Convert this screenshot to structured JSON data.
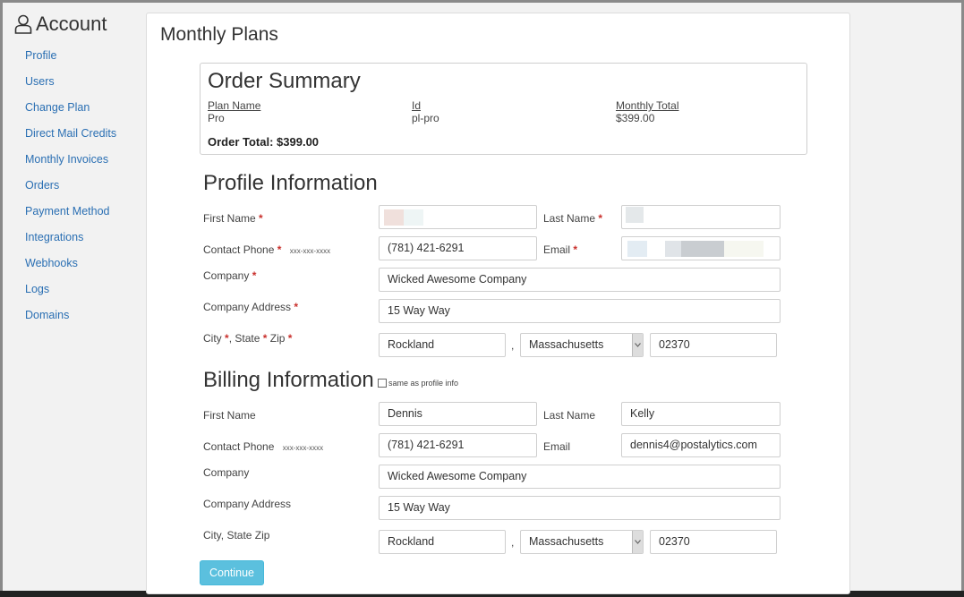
{
  "sidebar": {
    "title": "Account",
    "items": [
      "Profile",
      "Users",
      "Change Plan",
      "Direct Mail Credits",
      "Monthly Invoices",
      "Orders",
      "Payment Method",
      "Integrations",
      "Webhooks",
      "Logs",
      "Domains"
    ]
  },
  "main": {
    "title": "Monthly Plans",
    "order_summary": {
      "title": "Order Summary",
      "columns": [
        {
          "header": "Plan Name",
          "value": "Pro"
        },
        {
          "header": "Id",
          "value": "pl-pro"
        },
        {
          "header": "Monthly Total",
          "value": "$399.00"
        }
      ],
      "total": "Order Total: $399.00"
    },
    "profile": {
      "title": "Profile Information",
      "first_name_label": "First Name",
      "last_name_label": "Last Name",
      "phone_label": "Contact Phone",
      "phone_hint": "xxx-xxx-xxxx",
      "phone_value": "(781) 421-6291",
      "email_label": "Email",
      "company_label": "Company",
      "company_value": "Wicked Awesome Company",
      "address_label": "Company Address",
      "address_value": "15 Way Way",
      "city_label": "City",
      "state_label": "State",
      "zip_label": "Zip",
      "city_value": "Rockland",
      "state_value": "Massachusetts",
      "zip_value": "02370",
      "required_mark": "*",
      "comma": ","
    },
    "billing": {
      "title": "Billing Information",
      "same_as_label": "same as profile info",
      "first_name_label": "First Name",
      "first_name_value": "Dennis",
      "last_name_label": "Last Name",
      "last_name_value": "Kelly",
      "phone_label": "Contact Phone",
      "phone_hint": "xxx-xxx-xxxx",
      "phone_value": "(781) 421-6291",
      "email_label": "Email",
      "email_value": "dennis4@postalytics.com",
      "company_label": "Company",
      "company_value": "Wicked Awesome Company",
      "address_label": "Company Address",
      "address_value": "15 Way Way",
      "city_state_zip_label": "City, State Zip",
      "city_value": "Rockland",
      "state_value": "Massachusetts",
      "zip_value": "02370",
      "comma": ","
    },
    "continue_label": "Continue"
  },
  "colors": {
    "link": "#2a6fb3",
    "required": "#c9302c",
    "button": "#5bc0de"
  },
  "icons": {
    "account": "user-outline-icon",
    "select": "chevron-down-icon"
  }
}
